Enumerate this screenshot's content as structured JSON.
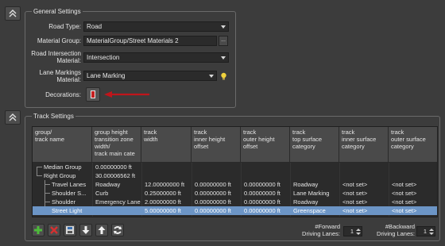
{
  "general": {
    "title": "General Settings",
    "road_type_label": "Road Type:",
    "road_type_value": "Road",
    "material_group_label": "Material Group:",
    "material_group_value": "MaterialGroup/Street Materials 2",
    "browse_label": "...",
    "intersection_label": "Road Intersection\nMaterial:",
    "intersection_value": "Intersection",
    "lane_markings_label": "Lane Markings\nMaterial:",
    "lane_markings_value": "Lane Marking",
    "decorations_label": "Decorations:",
    "annotation_color": "#c0151b"
  },
  "track": {
    "title": "Track Settings",
    "columns": [
      "group/\ntrack name",
      "group height\ntransition zone\nwidth/\ntrack main cate",
      "track\nwidth",
      "track\ninner height\noffset",
      "track\nouter height\noffset",
      "track\ntop surface\ncategory",
      "track\ninner surface\ncategory",
      "track\nouter surface\ncategory"
    ],
    "rows": [
      {
        "name": "Median Group",
        "c1": "0.00000000 ft",
        "c2": "",
        "c3": "",
        "c4": "",
        "c5": "",
        "c6": "",
        "c7": ""
      },
      {
        "name": "Right Group",
        "c1": "30.00006562 ft",
        "c2": "",
        "c3": "",
        "c4": "",
        "c5": "",
        "c6": "",
        "c7": ""
      },
      {
        "name": "Travel Lanes",
        "c1": "Roadway",
        "c2": "12.00000000 ft",
        "c3": "0.00000000 ft",
        "c4": "0.00000000 ft",
        "c5": "Roadway",
        "c6": "<not set>",
        "c7": "<not set>"
      },
      {
        "name": "Shoulder S...",
        "c1": "Curb",
        "c2": "0.25000000 ft",
        "c3": "0.00000000 ft",
        "c4": "0.00000000 ft",
        "c5": "Lane Marking",
        "c6": "<not set>",
        "c7": "<not set>"
      },
      {
        "name": "Shoulder",
        "c1": "Emergency Lane",
        "c2": "2.00000000 ft",
        "c3": "0.00000000 ft",
        "c4": "0.00000000 ft",
        "c5": "Roadway",
        "c6": "<not set>",
        "c7": "<not set>"
      },
      {
        "name": "Street Light",
        "c1": "",
        "c2": "5.00000000 ft",
        "c3": "0.00000000 ft",
        "c4": "0.00000000 ft",
        "c5": "Greenspace",
        "c6": "<not set>",
        "c7": "<not set>"
      }
    ],
    "selected_row": 5,
    "selection_color": "#6c95c6",
    "forward_label": "#Forward\nDriving Lanes:",
    "forward_value": "1",
    "backward_label": "#Backward\nDriving Lanes:",
    "backward_value": "1"
  },
  "toolbar": {
    "icons": [
      "add-icon",
      "delete-icon",
      "save-icon",
      "move-down-icon",
      "move-up-icon",
      "refresh-icon"
    ]
  }
}
